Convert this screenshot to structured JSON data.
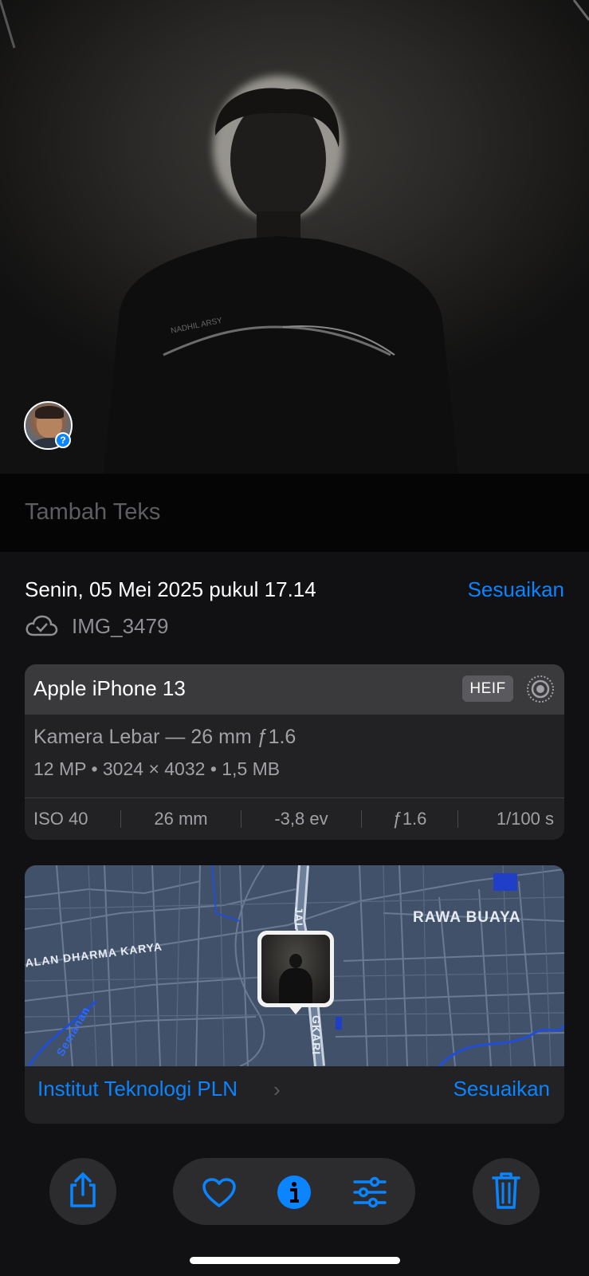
{
  "photo": {
    "caption_placeholder": "Tambah Teks",
    "people_badge": "?"
  },
  "info": {
    "date": "Senin, 05 Mei 2025 pukul 17.14",
    "adjust_label": "Sesuaikan",
    "filename": "IMG_3479"
  },
  "camera": {
    "device": "Apple iPhone 13",
    "format_badge": "HEIF",
    "lens": "Kamera Lebar — 26 mm ƒ1.6",
    "specs": "12 MP  •  3024 × 4032  •  1,5 MB",
    "exif": [
      "ISO 40",
      "26 mm",
      "-3,8 ev",
      "ƒ1.6",
      "1/100 s"
    ]
  },
  "map": {
    "labels": {
      "area": "RAWA BUAYA",
      "road_left": "ALAN DHARMA KARYA",
      "road_top": "JAL",
      "road_bottom": "GKARI",
      "river": "Semanan"
    },
    "place": "Institut Teknologi PLN",
    "adjust_label": "Sesuaikan"
  },
  "toolbar": {
    "icons": [
      "share-icon",
      "heart-icon",
      "info-icon",
      "adjustments-icon",
      "trash-icon"
    ],
    "accent_color": "#0a84ff"
  }
}
